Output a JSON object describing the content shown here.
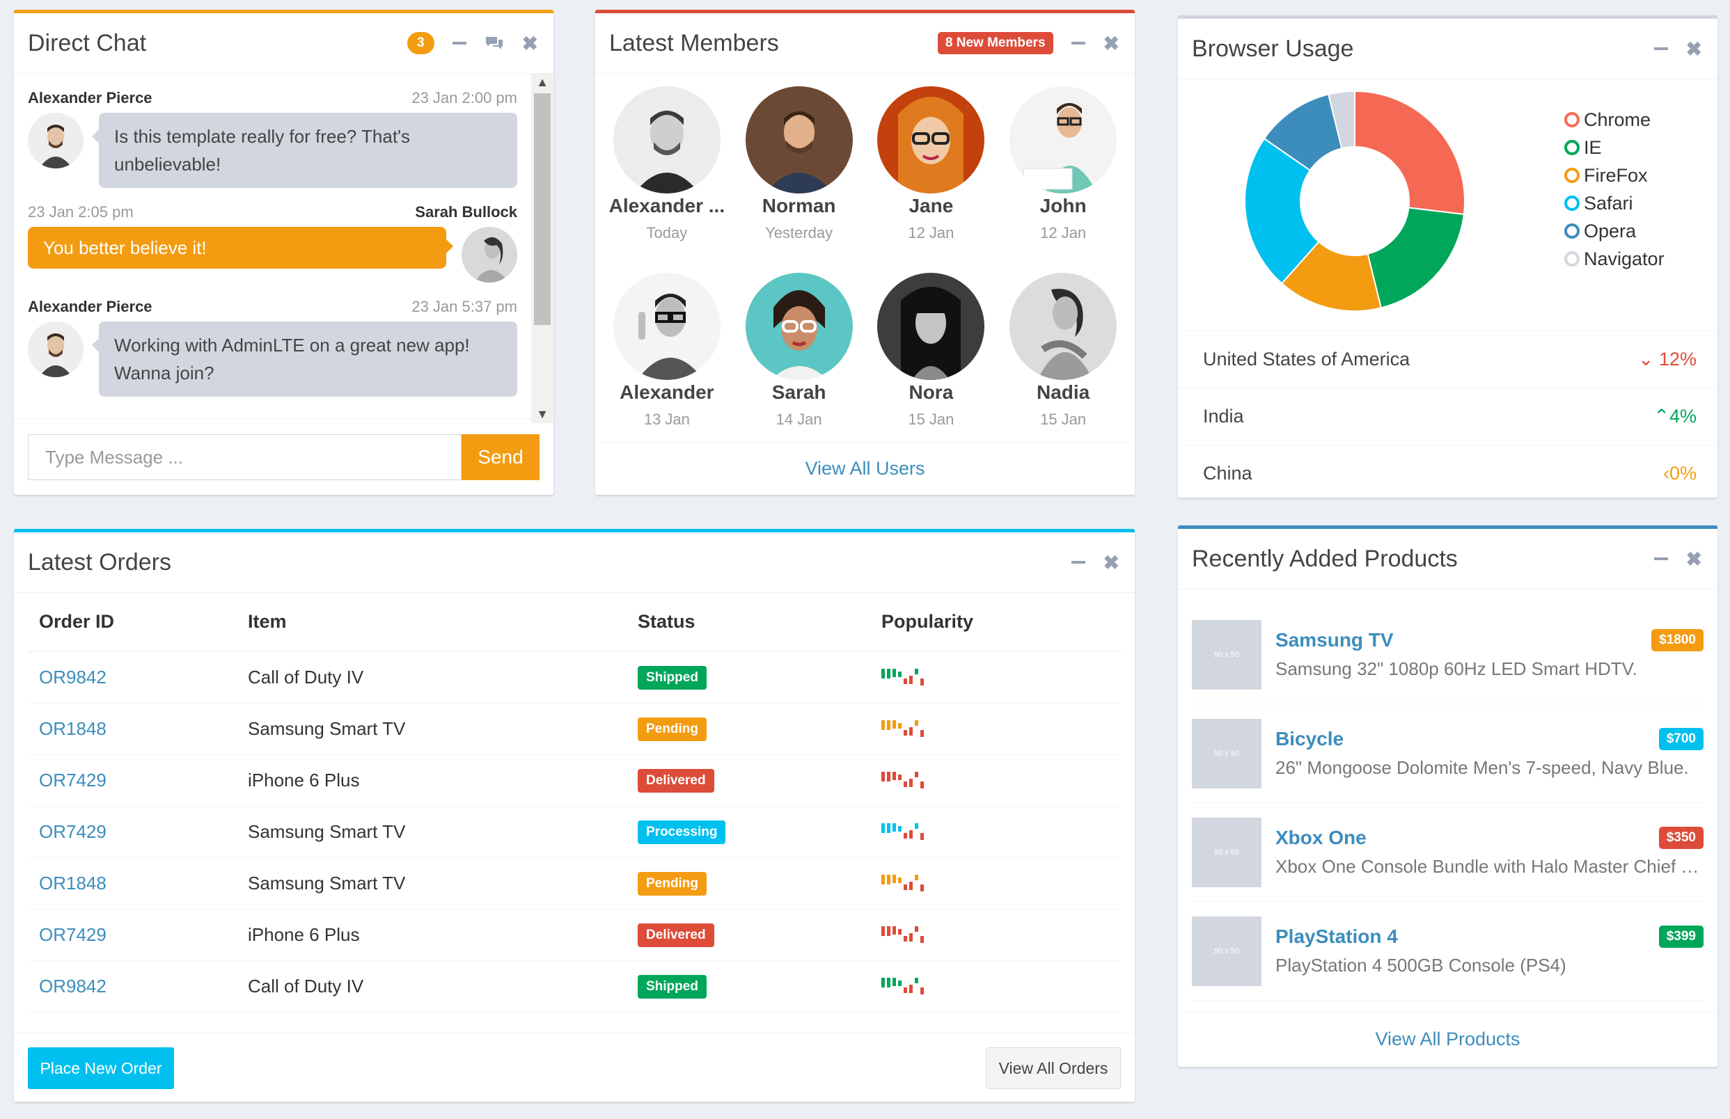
{
  "direct_chat": {
    "title": "Direct Chat",
    "badge_count": "3",
    "messages": [
      {
        "name": "Alexander Pierce",
        "time": "23 Jan 2:00 pm",
        "text": "Is this template really for free? That's unbelievable!",
        "side": "left"
      },
      {
        "name": "Sarah Bullock",
        "time": "23 Jan 2:05 pm",
        "text": "You better believe it!",
        "side": "right"
      },
      {
        "name": "Alexander Pierce",
        "time": "23 Jan 5:37 pm",
        "text": "Working with AdminLTE on a great new app! Wanna join?",
        "side": "left"
      }
    ],
    "input_placeholder": "Type Message ...",
    "send_label": "Send",
    "accent": "#f39c12"
  },
  "latest_members": {
    "title": "Latest Members",
    "badge": "8 New Members",
    "members": [
      {
        "name": "Alexander ...",
        "date": "Today"
      },
      {
        "name": "Norman",
        "date": "Yesterday"
      },
      {
        "name": "Jane",
        "date": "12 Jan"
      },
      {
        "name": "John",
        "date": "12 Jan"
      },
      {
        "name": "Alexander",
        "date": "13 Jan"
      },
      {
        "name": "Sarah",
        "date": "14 Jan"
      },
      {
        "name": "Nora",
        "date": "15 Jan"
      },
      {
        "name": "Nadia",
        "date": "15 Jan"
      }
    ],
    "footer_link": "View All Users",
    "accent": "#dd4b39"
  },
  "browser_usage": {
    "title": "Browser Usage",
    "legend": [
      {
        "name": "Chrome",
        "color": "#f56954"
      },
      {
        "name": "IE",
        "color": "#00a65a"
      },
      {
        "name": "FireFox",
        "color": "#f39c12"
      },
      {
        "name": "Safari",
        "color": "#00c0ef"
      },
      {
        "name": "Opera",
        "color": "#3c8dbc"
      },
      {
        "name": "Navigator",
        "color": "#d2d6de"
      }
    ],
    "countries": [
      {
        "name": "United States of America",
        "change": "12%",
        "direction": "down",
        "color": "#dd4b39"
      },
      {
        "name": "India",
        "change": "4%",
        "direction": "up",
        "color": "#00a65a"
      },
      {
        "name": "China",
        "change": "0%",
        "direction": "left",
        "color": "#f39c12"
      }
    ]
  },
  "chart_data": {
    "type": "pie",
    "title": "",
    "categories": [
      "Chrome",
      "IE",
      "FireFox",
      "Safari",
      "Opera",
      "Navigator"
    ],
    "values": [
      700,
      500,
      400,
      600,
      300,
      100
    ],
    "colors": [
      "#f56954",
      "#00a65a",
      "#f39c12",
      "#00c0ef",
      "#3c8dbc",
      "#d2d6de"
    ],
    "donut": true,
    "legend": "right"
  },
  "latest_orders": {
    "title": "Latest Orders",
    "columns": [
      "Order ID",
      "Item",
      "Status",
      "Popularity"
    ],
    "rows": [
      {
        "id": "OR9842",
        "item": "Call of Duty IV",
        "status": "Shipped",
        "color": "#00a65a"
      },
      {
        "id": "OR1848",
        "item": "Samsung Smart TV",
        "status": "Pending",
        "color": "#f39c12"
      },
      {
        "id": "OR7429",
        "item": "iPhone 6 Plus",
        "status": "Delivered",
        "color": "#dd4b39"
      },
      {
        "id": "OR7429",
        "item": "Samsung Smart TV",
        "status": "Processing",
        "color": "#00c0ef"
      },
      {
        "id": "OR1848",
        "item": "Samsung Smart TV",
        "status": "Pending",
        "color": "#f39c12"
      },
      {
        "id": "OR7429",
        "item": "iPhone 6 Plus",
        "status": "Delivered",
        "color": "#dd4b39"
      },
      {
        "id": "OR9842",
        "item": "Call of Duty IV",
        "status": "Shipped",
        "color": "#00a65a"
      }
    ],
    "place_order_label": "Place New Order",
    "view_all_label": "View All Orders",
    "accent": "#00c0ef"
  },
  "recent_products": {
    "title": "Recently Added Products",
    "products": [
      {
        "name": "Samsung TV",
        "desc": "Samsung 32\" 1080p 60Hz LED Smart HDTV.",
        "price": "$1800",
        "color": "#f39c12",
        "thumb": "50 x 50"
      },
      {
        "name": "Bicycle",
        "desc": "26\" Mongoose Dolomite Men's 7-speed, Navy Blue.",
        "price": "$700",
        "color": "#00c0ef",
        "thumb": "50 x 50"
      },
      {
        "name": "Xbox One",
        "desc": "Xbox One Console Bundle with Halo Master Chief Collection.",
        "price": "$350",
        "color": "#dd4b39",
        "thumb": "50 x 50"
      },
      {
        "name": "PlayStation 4",
        "desc": "PlayStation 4 500GB Console (PS4)",
        "price": "$399",
        "color": "#00a65a",
        "thumb": "50 x 50"
      }
    ],
    "footer_link": "View All Products",
    "accent": "#3c8dbc"
  }
}
